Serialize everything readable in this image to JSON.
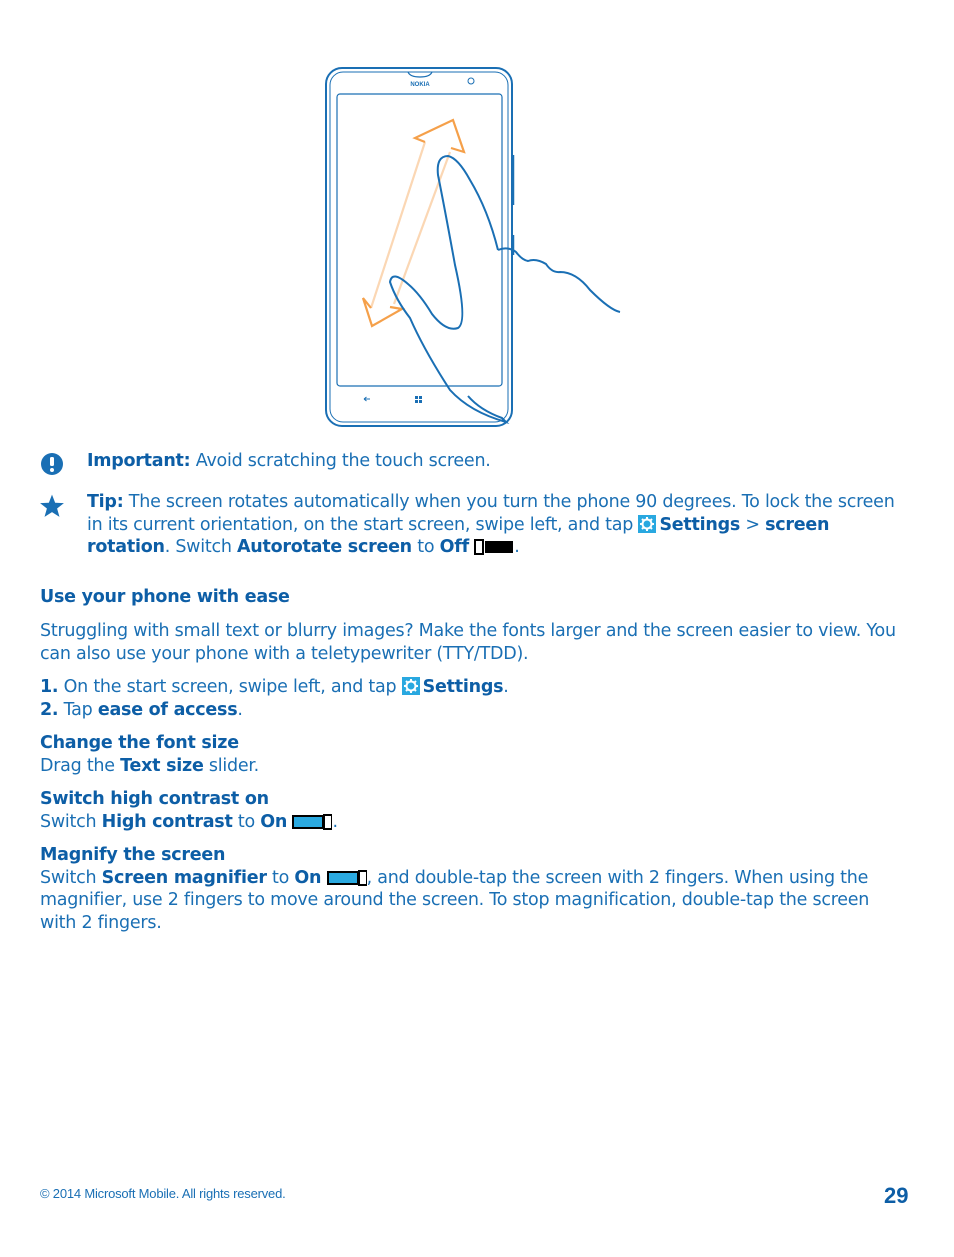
{
  "illustration": {
    "brand_text": "NOKIA",
    "description": "phone-pinch-zoom-gesture"
  },
  "important": {
    "icon": "exclamation-icon",
    "label": "Important:",
    "text": " Avoid scratching the touch screen."
  },
  "tip": {
    "icon": "star-icon",
    "label": "Tip:",
    "line1": " The screen rotates automatically when you turn the phone 90 degrees. To lock the screen",
    "line2_a": "in its current orientation, on the start screen, swipe left, and tap ",
    "settings": "Settings",
    "sep": " > ",
    "screen": "screen",
    "rotation": "rotation",
    "line3_a": ". Switch ",
    "autorotate": "Autorotate screen",
    "to": " to ",
    "off": "Off",
    "end": "."
  },
  "section": {
    "title": "Use your phone with ease",
    "intro_1": "Struggling with small text or blurry images? Make the fonts larger and the screen easier to view. You",
    "intro_2": "can also use your phone with a teletypewriter (TTY/TDD).",
    "steps": [
      {
        "num": "1.",
        "text_a": " On the start screen, swipe left, and tap ",
        "bold": "Settings",
        "end": "."
      },
      {
        "num": "2.",
        "text_a": " Tap ",
        "bold": "ease of access",
        "end": "."
      }
    ]
  },
  "font_size": {
    "title": "Change the font size",
    "a": "Drag the ",
    "bold": "Text size",
    "b": " slider."
  },
  "high_contrast": {
    "title": "Switch high contrast on",
    "a": "Switch ",
    "bold": "High contrast",
    "to": " to ",
    "on": "On",
    "end": "."
  },
  "magnify": {
    "title": "Magnify the screen",
    "a": "Switch ",
    "bold": "Screen magnifier",
    "to": " to ",
    "on": "On",
    "b": ", and double-tap the screen with 2 fingers. When using the",
    "line2": "magnifier, use 2 fingers to move around the screen. To stop magnification, double-tap the screen",
    "line3": "with 2 fingers."
  },
  "footer": {
    "copyright": "© 2014 Microsoft Mobile. All rights reserved.",
    "page_number": "29"
  },
  "colors": {
    "text": "#1a6fb4",
    "heading": "#0d5ea6",
    "settings_tile": "#29a8e0",
    "arrow": "#f5a04a"
  }
}
